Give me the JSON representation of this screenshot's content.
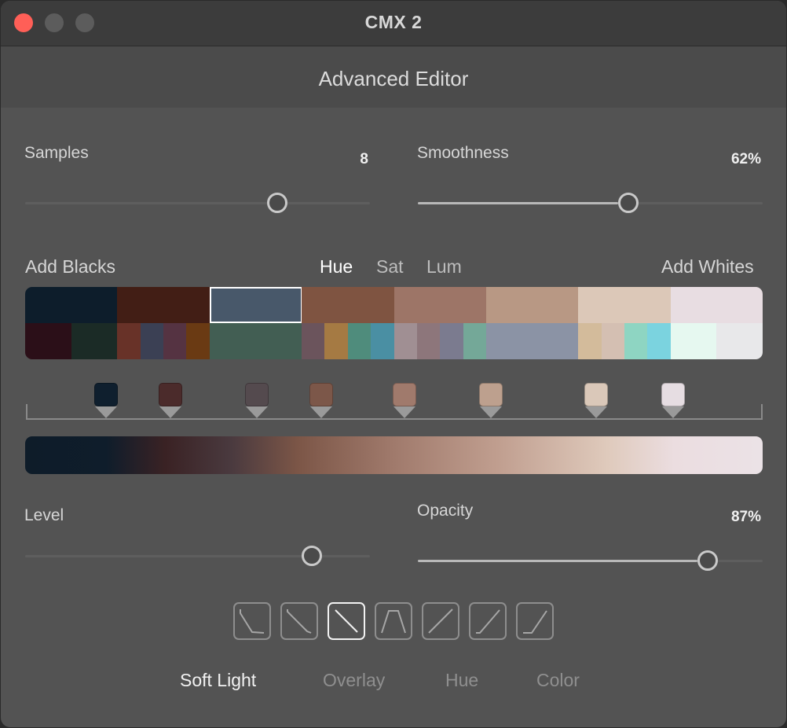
{
  "window": {
    "title": "CMX 2"
  },
  "header": {
    "title": "Advanced Editor"
  },
  "samples": {
    "label": "Samples",
    "value": "8"
  },
  "smoothness": {
    "label": "Smoothness",
    "value": "62%"
  },
  "tone": {
    "add_blacks": "Add Blacks",
    "add_whites": "Add Whites",
    "tabs": [
      {
        "label": "Hue",
        "active": true
      },
      {
        "label": "Sat",
        "active": false
      },
      {
        "label": "Lum",
        "active": false
      }
    ]
  },
  "palette": {
    "top_row": [
      "#0d1d2b",
      "#421e15",
      "#48586a",
      "#7f5441",
      "#9d7567",
      "#b89884",
      "#dcc8b8",
      "#e8dde2"
    ],
    "selected_index": 2,
    "bottom_row": [
      "#2b0f18",
      "#1b2b26",
      "#683228",
      "#3b4054",
      "#553342",
      "#6a3a13",
      "#425e53",
      "#6b545c",
      "#a57a43",
      "#4f8c7c",
      "#4a8fa3",
      "#a08f93",
      "#8d767b",
      "#7b7b8f",
      "#74a898",
      "#8b93a5",
      "#d3bb9b",
      "#d4bfb2",
      "#8ed5c2",
      "#7bd3df",
      "#e6f8f0",
      "#e8e8ea"
    ]
  },
  "gradient_markers": [
    "#0f1f2e",
    "#4b2b2b",
    "#544a4e",
    "#7c5749",
    "#a07a6c",
    "#bda08e",
    "#dac8b9",
    "#e6dde2"
  ],
  "level": {
    "label": "Level"
  },
  "opacity": {
    "label": "Opacity",
    "value": "87%"
  },
  "curve_presets": {
    "icons": [
      "curve-shoulder-icon",
      "curve-linear-down-icon",
      "curve-diagonal-icon",
      "curve-bell-icon",
      "curve-linear-up-icon",
      "curve-toe-up-icon",
      "curve-toe-icon"
    ],
    "active_index": 2
  },
  "blend_modes": [
    {
      "label": "Soft Light",
      "active": true
    },
    {
      "label": "Overlay",
      "active": false
    },
    {
      "label": "Hue",
      "active": false
    },
    {
      "label": "Color",
      "active": false
    }
  ]
}
